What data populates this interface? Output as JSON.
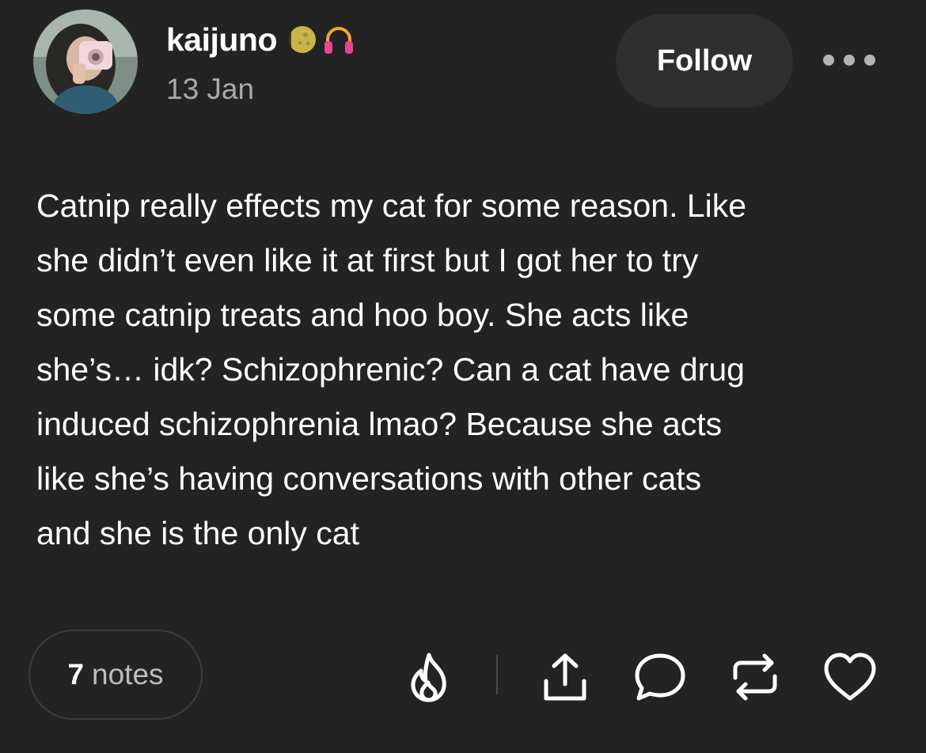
{
  "post": {
    "author": {
      "username": "kaijuno",
      "badges": [
        "moon-badge-icon",
        "headphones-badge-icon"
      ]
    },
    "date": "13 Jan",
    "follow_label": "Follow",
    "body_lines": [
      "Catnip really effects my cat for some reason. Like",
      "she didn’t even like it at first but I got her to try",
      "some catnip treats and hoo boy. She acts like",
      "she’s… idk? Schizophrenic? Can a cat have drug",
      "induced schizophrenia lmao? Because she acts",
      "like she’s having conversations with other cats",
      "and she is the only cat"
    ],
    "notes": {
      "count": "7",
      "label": "notes"
    },
    "actions": [
      "fire-icon",
      "share-icon",
      "reply-icon",
      "reblog-icon",
      "like-icon"
    ]
  },
  "colors": {
    "background": "#232323",
    "text": "#ffffff",
    "muted_text": "#a9a9a9",
    "button_bg": "#2f2f2f",
    "icon": "#ffffff"
  }
}
